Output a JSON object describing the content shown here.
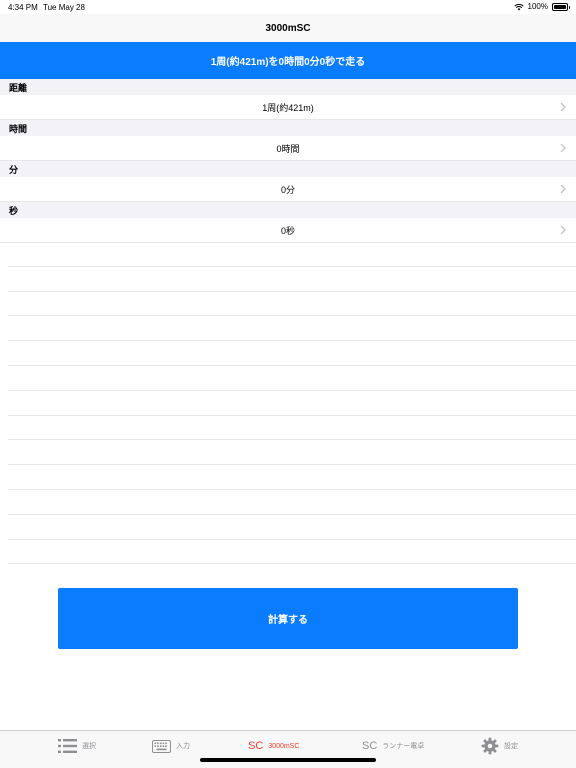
{
  "status_bar": {
    "time": "4:34 PM",
    "date": "Tue May 28",
    "battery": "100%"
  },
  "nav": {
    "title": "3000mSC"
  },
  "banner": {
    "text": "1周(約421m)を0時間0分0秒で走る"
  },
  "form": {
    "sections": [
      {
        "header": "距離",
        "value": "1周(約421m)"
      },
      {
        "header": "時間",
        "value": "0時間"
      },
      {
        "header": "分",
        "value": "0分"
      },
      {
        "header": "秒",
        "value": "0秒"
      }
    ]
  },
  "calc_button": {
    "label": "計算する"
  },
  "tabs": [
    {
      "label": "選択",
      "icon": "list-icon"
    },
    {
      "label": "入力",
      "icon": "keyboard-icon"
    },
    {
      "label": "3000mSC",
      "glyph": "SC",
      "active": true
    },
    {
      "label": "ランナー電卓",
      "glyph": "SC"
    },
    {
      "label": "設定",
      "icon": "gear-icon"
    }
  ],
  "colors": {
    "accent": "#0a7cff",
    "active_tab": "#ff3b30",
    "inactive_tab": "#8e8e93"
  }
}
